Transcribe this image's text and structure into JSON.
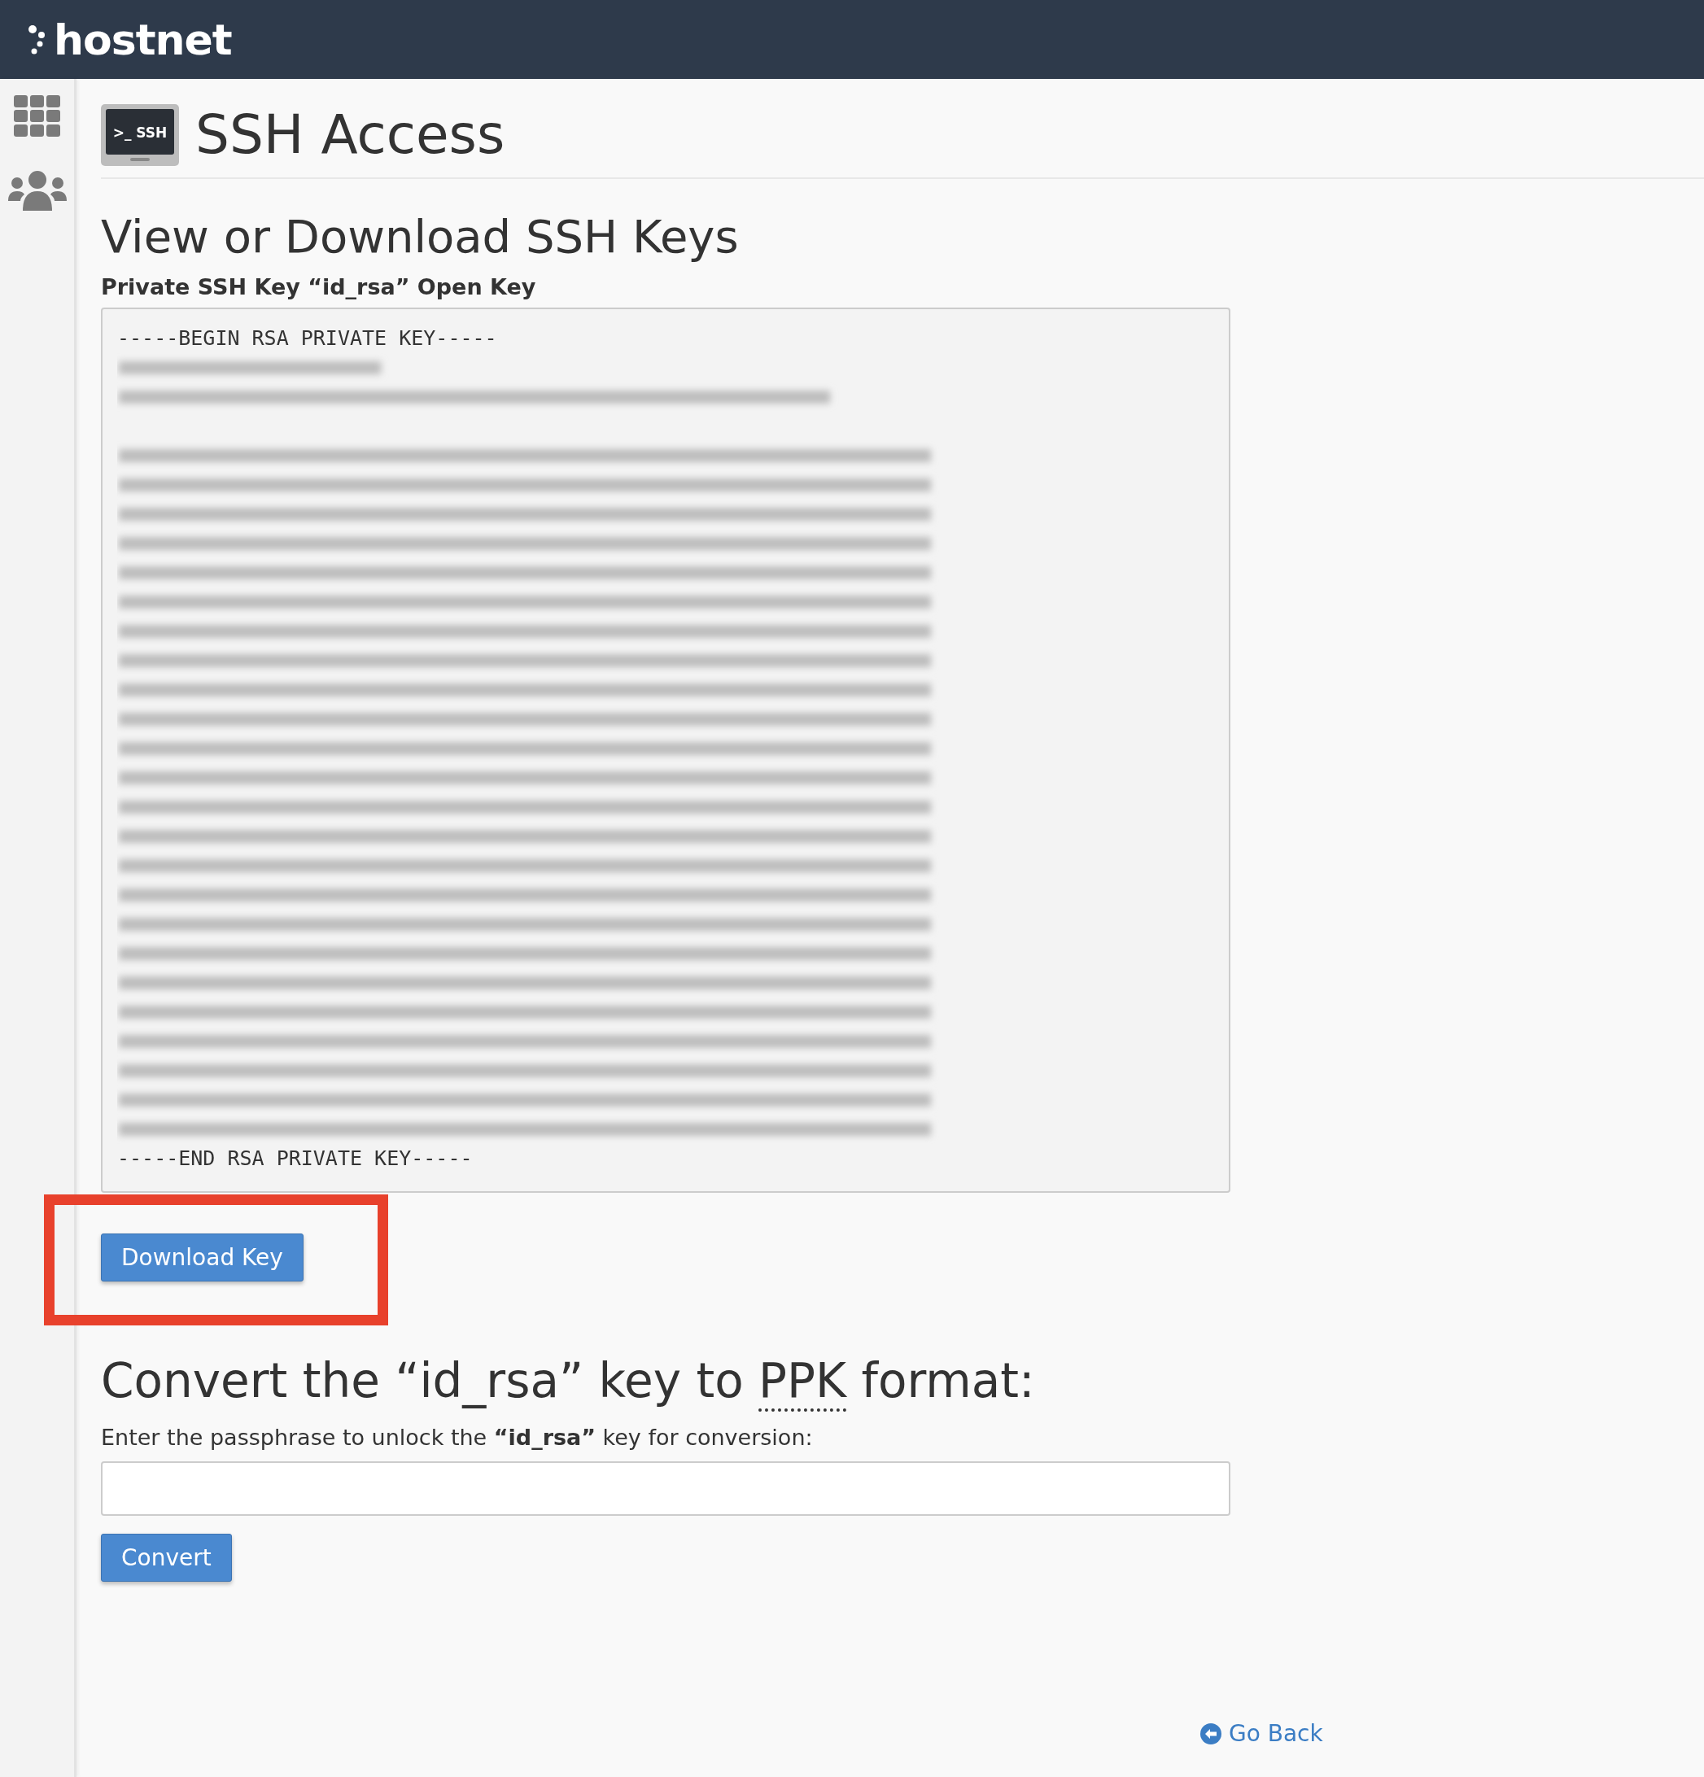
{
  "header": {
    "logo": "hostnet"
  },
  "sidebar": {
    "items": [
      {
        "kind": "grid"
      },
      {
        "kind": "users"
      }
    ]
  },
  "page": {
    "icon_text": ">_ SSH",
    "title": "SSH Access"
  },
  "key_section": {
    "title": "View or Download SSH Keys",
    "label": "Private SSH Key “id_rsa” Open Key",
    "begin_line": "-----BEGIN RSA PRIVATE KEY-----",
    "end_line": "-----END RSA PRIVATE KEY-----",
    "download_button": "Download Key",
    "annotation": {
      "kind": "highlight-box"
    }
  },
  "convert_section": {
    "title_before": "Convert the “id_rsa” key to ",
    "title_abbr": "PPK",
    "title_after": " format:",
    "label": "Enter the passphrase to unlock the **“id_rsa”** key for conversion:",
    "convert_button": "Convert"
  },
  "go_back": "Go Back"
}
